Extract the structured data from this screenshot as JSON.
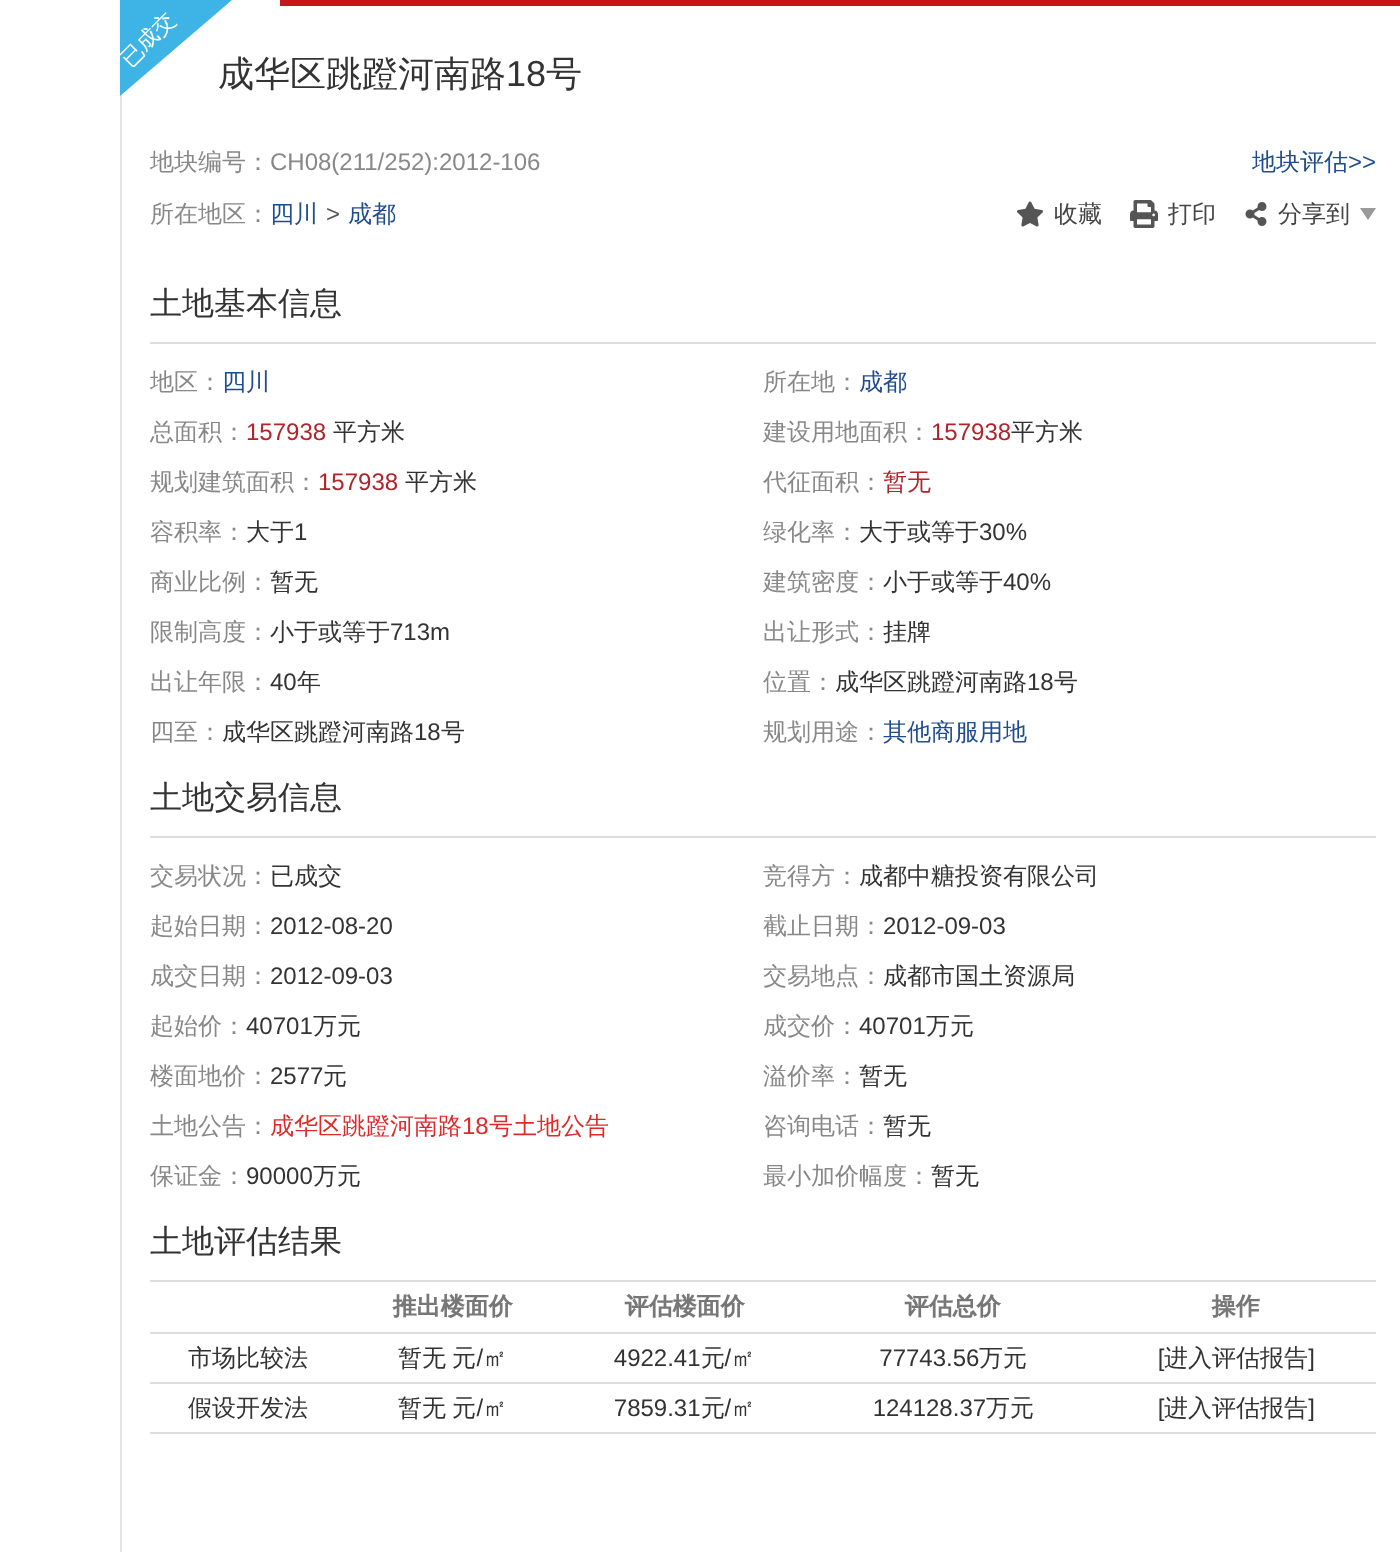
{
  "ribbon": "已成交",
  "title": "成华区跳蹬河南路18号",
  "parcel_no": {
    "label": "地块编号：",
    "value": "CH08(211/252):2012-106"
  },
  "evaluate_link": "地块评估>>",
  "region": {
    "label": "所在地区：",
    "province": "四川",
    "separator": ">",
    "city": "成都"
  },
  "actions": [
    {
      "kind": "star",
      "label": "收藏"
    },
    {
      "kind": "print",
      "label": "打印"
    },
    {
      "kind": "share",
      "label": "分享到"
    }
  ],
  "sections": [
    {
      "title": "土地基本信息",
      "fields": [
        {
          "label": "地区：",
          "parts": [
            {
              "text": "四川",
              "kind": "link"
            }
          ]
        },
        {
          "label": "所在地：",
          "parts": [
            {
              "text": "成都",
              "kind": "link"
            }
          ]
        },
        {
          "label": "总面积：",
          "parts": [
            {
              "text": "157938",
              "kind": "red"
            },
            {
              "text": " 平方米",
              "kind": "plain"
            }
          ]
        },
        {
          "label": "建设用地面积：",
          "parts": [
            {
              "text": "157938",
              "kind": "red"
            },
            {
              "text": "平方米",
              "kind": "plain"
            }
          ]
        },
        {
          "label": "规划建筑面积：",
          "parts": [
            {
              "text": "157938",
              "kind": "red"
            },
            {
              "text": " 平方米",
              "kind": "plain"
            }
          ]
        },
        {
          "label": "代征面积：",
          "parts": [
            {
              "text": "暂无",
              "kind": "red"
            }
          ]
        },
        {
          "label": "容积率：",
          "parts": [
            {
              "text": "大于1",
              "kind": "plain"
            }
          ]
        },
        {
          "label": "绿化率：",
          "parts": [
            {
              "text": "大于或等于30%",
              "kind": "plain"
            }
          ]
        },
        {
          "label": "商业比例：",
          "parts": [
            {
              "text": "暂无",
              "kind": "plain"
            }
          ]
        },
        {
          "label": "建筑密度：",
          "parts": [
            {
              "text": "小于或等于40%",
              "kind": "plain"
            }
          ]
        },
        {
          "label": "限制高度：",
          "parts": [
            {
              "text": "小于或等于713m",
              "kind": "plain"
            }
          ]
        },
        {
          "label": "出让形式：",
          "parts": [
            {
              "text": "挂牌",
              "kind": "plain"
            }
          ]
        },
        {
          "label": "出让年限：",
          "parts": [
            {
              "text": "40年",
              "kind": "plain"
            }
          ]
        },
        {
          "label": "位置：",
          "parts": [
            {
              "text": "成华区跳蹬河南路18号",
              "kind": "plain"
            }
          ]
        },
        {
          "label": "四至：",
          "parts": [
            {
              "text": "成华区跳蹬河南路18号",
              "kind": "plain"
            }
          ]
        },
        {
          "label": "规划用途：",
          "parts": [
            {
              "text": "其他商服用地",
              "kind": "link"
            }
          ]
        }
      ]
    },
    {
      "title": "土地交易信息",
      "fields": [
        {
          "label": "交易状况：",
          "parts": [
            {
              "text": "已成交",
              "kind": "plain"
            }
          ]
        },
        {
          "label": "竞得方：",
          "parts": [
            {
              "text": "成都中糖投资有限公司",
              "kind": "plain"
            }
          ]
        },
        {
          "label": "起始日期：",
          "parts": [
            {
              "text": "2012-08-20",
              "kind": "plain"
            }
          ]
        },
        {
          "label": "截止日期：",
          "parts": [
            {
              "text": "2012-09-03",
              "kind": "plain"
            }
          ]
        },
        {
          "label": "成交日期：",
          "parts": [
            {
              "text": "2012-09-03",
              "kind": "plain"
            }
          ]
        },
        {
          "label": "交易地点：",
          "parts": [
            {
              "text": "成都市国土资源局",
              "kind": "plain"
            }
          ]
        },
        {
          "label": "起始价：",
          "parts": [
            {
              "text": "40701万元",
              "kind": "plain"
            }
          ]
        },
        {
          "label": "成交价：",
          "parts": [
            {
              "text": "40701万元",
              "kind": "plain"
            }
          ]
        },
        {
          "label": "楼面地价：",
          "parts": [
            {
              "text": "2577元",
              "kind": "plain"
            }
          ]
        },
        {
          "label": "溢价率：",
          "parts": [
            {
              "text": "暂无",
              "kind": "plain"
            }
          ]
        },
        {
          "label": "土地公告：",
          "parts": [
            {
              "text": "成华区跳蹬河南路18号土地公告",
              "kind": "redlink"
            }
          ]
        },
        {
          "label": "咨询电话：",
          "parts": [
            {
              "text": "暂无",
              "kind": "plain"
            }
          ]
        },
        {
          "label": "保证金：",
          "parts": [
            {
              "text": "90000万元",
              "kind": "plain"
            }
          ]
        },
        {
          "label": "最小加价幅度：",
          "parts": [
            {
              "text": "暂无",
              "kind": "plain"
            }
          ]
        }
      ]
    }
  ],
  "evaluation": {
    "title": "土地评估结果",
    "columns": [
      "推出楼面价",
      "评估楼面价",
      "评估总价",
      "操作"
    ],
    "rows": [
      {
        "method": "市场比较法",
        "listed_price": "暂无 元/㎡",
        "assessed_price": "4922.41元/㎡",
        "assessed_total": "77743.56万元",
        "action": "[进入评估报告]"
      },
      {
        "method": "假设开发法",
        "listed_price": "暂无 元/㎡",
        "assessed_price": "7859.31元/㎡",
        "assessed_total": "124128.37万元",
        "action": "[进入评估报告]"
      }
    ]
  }
}
